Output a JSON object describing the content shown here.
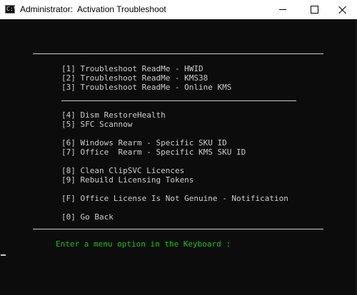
{
  "window": {
    "title": "Administrator:  Activation Troubleshoot",
    "icon": "cmd-icon",
    "icon_text": "C:\\"
  },
  "controls": {
    "minimize": "minimize-icon",
    "maximize": "maximize-icon",
    "close": "close-icon"
  },
  "menu": {
    "items": [
      "[1] Troubleshoot ReadMe - HWID",
      "[2] Troubleshoot ReadMe - KMS38",
      "[3] Troubleshoot ReadMe - Online KMS",
      "[4] Dism RestoreHealth",
      "[5] SFC Scannow",
      "[6] Windows Rearm - Specific SKU ID",
      "[7] Office  Rearm - Specific KMS SKU ID",
      "[8] Clean ClipSVC Licences",
      "[9] Rebuild Licensing Tokens",
      "[F] Office License Is Not Genuine - Notification",
      "[0] Go Back"
    ],
    "prompt": "Enter a menu option in the Keyboard :"
  },
  "colors": {
    "console_bg": "#0c0c0c",
    "console_text": "#cccccc",
    "prompt_text": "#13c40e"
  }
}
